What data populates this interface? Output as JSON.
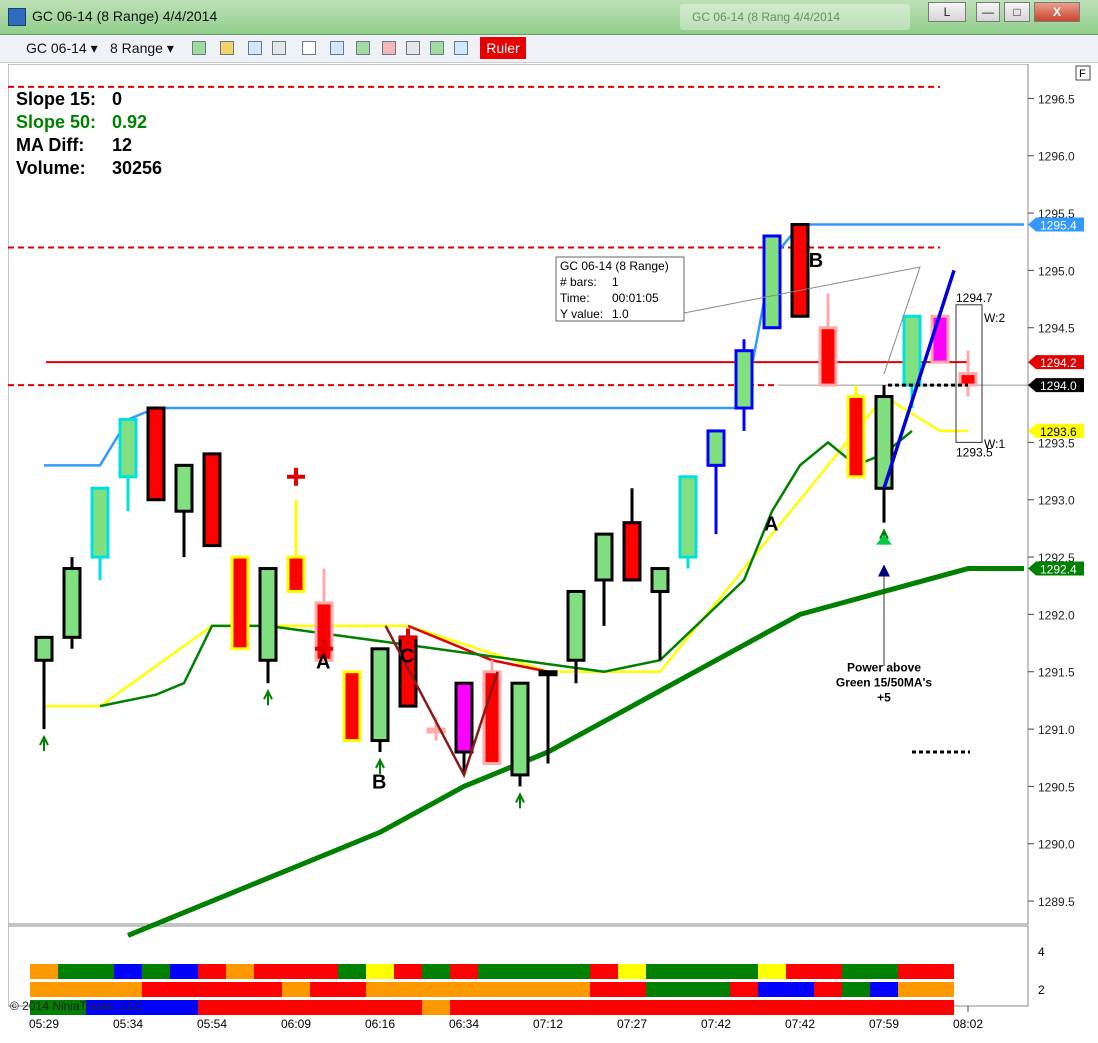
{
  "window": {
    "title": "GC 06-14 (8 Range)  4/4/2014",
    "background_title": "GC 06-14 (8 Rang   4/4/2014",
    "layout_button": "L",
    "minimize_label": "—",
    "maximize_label": "□",
    "close_label": "X"
  },
  "toolbar": {
    "instrument": "GC 06-14",
    "interval": "8 Range",
    "ruler_label": "Ruler",
    "icons": [
      "bar-type-icon",
      "pencil-icon",
      "zoom-in-icon",
      "zoom-out-icon",
      "crosshair-icon",
      "magnifier-icon",
      "indicators-icon",
      "strategies-icon",
      "chart-style-icon",
      "dollar-icon",
      "properties-icon"
    ]
  },
  "panel": {
    "f_label": "F",
    "copyright": "© 2014 NinjaTrader, LLC"
  },
  "stats": [
    {
      "label": "Slope 15:",
      "value": "0",
      "color": "#000000"
    },
    {
      "label": "Slope 50:",
      "value": "0.92",
      "color": "#008000"
    },
    {
      "label": "MA Diff:",
      "value": "12",
      "color": "#000000"
    },
    {
      "label": "Volume:",
      "value": "30256",
      "color": "#000000"
    }
  ],
  "ruler_box": {
    "line1": "GC 06-14 (8 Range)",
    "line2_label": "# bars:",
    "line2_value": "1",
    "line3_label": "Time:",
    "line3_value": "00:01:05",
    "line4_label": "Y value:",
    "line4_value": "1.0"
  },
  "annotations": {
    "power_text_1": "Power above",
    "power_text_2": "Green 15/50MA's",
    "power_text_3": "+5",
    "target_high": "1294.7",
    "target_low": "1293.5",
    "w2": "W:2",
    "w1": "W:1",
    "abc": [
      {
        "text": "A",
        "x": 10,
        "y": 1291.6
      },
      {
        "text": "B",
        "x": 12,
        "y": 1290.55
      },
      {
        "text": "C",
        "x": 13,
        "y": 1291.65
      },
      {
        "text": "A",
        "x": 26,
        "y": 1292.8
      },
      {
        "text": "B",
        "x": 27.6,
        "y": 1295.1
      }
    ]
  },
  "colors": {
    "ma15_up": "#3399ff",
    "ma_yellow": "#ffff00",
    "ma_red": "#e00000",
    "ma_green_thin": "#008000",
    "ma_green_thick": "#008000",
    "bull_fill": "#80e080",
    "bear_fill": "#ff0000",
    "resistance": "#e00000"
  },
  "price_tags": [
    {
      "label": "1295.4",
      "value": 1295.4,
      "bg": "#3399ff",
      "fg": "#ffffff"
    },
    {
      "label": "1294.2",
      "value": 1294.2,
      "bg": "#e00000",
      "fg": "#ffffff"
    },
    {
      "label": "1294.0",
      "value": 1294.0,
      "bg": "#000000",
      "fg": "#ffffff"
    },
    {
      "label": "1293.6",
      "value": 1293.6,
      "bg": "#ffff00",
      "fg": "#000000"
    },
    {
      "label": "1292.4",
      "value": 1292.4,
      "bg": "#008000",
      "fg": "#ffffff"
    }
  ],
  "lower_panel": {
    "y_ticks": [
      "4",
      "2"
    ],
    "rows": [
      [
        "#ff9900",
        "#008000",
        "#008000",
        "#0000ff",
        "#008000",
        "#0000ff",
        "#ff0000",
        "#ff9900",
        "#ff0000",
        "#ff0000",
        "#ff0000",
        "#008000",
        "#ffff00",
        "#ff0000",
        "#008000",
        "#ff0000",
        "#008000",
        "#008000",
        "#008000",
        "#008000",
        "#ff0000",
        "#ffff00",
        "#008000",
        "#008000",
        "#008000",
        "#008000",
        "#ffff00",
        "#ff0000",
        "#ff0000",
        "#008000",
        "#008000",
        "#ff0000",
        "#ff0000"
      ],
      [
        "#ff9900",
        "#ff9900",
        "#ff9900",
        "#ff9900",
        "#ff0000",
        "#ff0000",
        "#ff0000",
        "#ff0000",
        "#ff0000",
        "#ff9900",
        "#ff0000",
        "#ff0000",
        "#ff9900",
        "#ff9900",
        "#ff9900",
        "#ff9900",
        "#ff9900",
        "#ff9900",
        "#ff9900",
        "#ff9900",
        "#ff0000",
        "#ff0000",
        "#008000",
        "#008000",
        "#008000",
        "#ff0000",
        "#0000ff",
        "#0000ff",
        "#ff0000",
        "#008000",
        "#0000ff",
        "#ff9900",
        "#ff9900"
      ],
      [
        "#008000",
        "#008000",
        "#0000ff",
        "#0000ff",
        "#0000ff",
        "#0000ff",
        "#ff0000",
        "#ff0000",
        "#ff0000",
        "#ff0000",
        "#ff0000",
        "#ff0000",
        "#ff0000",
        "#ff0000",
        "#ff9900",
        "#ff0000",
        "#ff0000",
        "#ff0000",
        "#ff0000",
        "#ff0000",
        "#ff0000",
        "#ff0000",
        "#ff0000",
        "#ff0000",
        "#ff0000",
        "#ff0000",
        "#ff0000",
        "#ff0000",
        "#ff0000",
        "#ff0000",
        "#ff0000",
        "#ff0000",
        "#ff0000"
      ]
    ]
  },
  "chart_data": {
    "type": "candlestick",
    "title": "GC 06-14 (8 Range)  4/4/2014",
    "ylim": [
      1289.3,
      1296.8
    ],
    "y_ticks": [
      "1296.5",
      "1296.0",
      "1295.5",
      "1295.0",
      "1294.5",
      "1294.0",
      "1293.5",
      "1293.0",
      "1292.5",
      "1292.0",
      "1291.5",
      "1291.0",
      "1290.5",
      "1290.0",
      "1289.5"
    ],
    "x_ticks": [
      {
        "label": "05:29",
        "x": 0
      },
      {
        "label": "05:34",
        "x": 3
      },
      {
        "label": "05:54",
        "x": 6
      },
      {
        "label": "06:09",
        "x": 9
      },
      {
        "label": "06:16",
        "x": 12
      },
      {
        "label": "06:34",
        "x": 15
      },
      {
        "label": "07:12",
        "x": 18
      },
      {
        "label": "07:27",
        "x": 21
      },
      {
        "label": "07:42",
        "x": 24
      },
      {
        "label": "07:42",
        "x": 27
      },
      {
        "label": "07:59",
        "x": 30
      },
      {
        "label": "08:02",
        "x": 33
      }
    ],
    "bars": [
      {
        "x": 0,
        "o": 1291.6,
        "h": 1291.8,
        "l": 1291.0,
        "c": 1291.8,
        "fill": "#80e080",
        "border": "#000000"
      },
      {
        "x": 1,
        "o": 1291.8,
        "h": 1292.5,
        "l": 1291.7,
        "c": 1292.4,
        "fill": "#80e080",
        "border": "#000000"
      },
      {
        "x": 2,
        "o": 1292.5,
        "h": 1293.1,
        "l": 1292.3,
        "c": 1293.1,
        "fill": "#80e080",
        "border": "#00e0e0"
      },
      {
        "x": 3,
        "o": 1293.2,
        "h": 1293.7,
        "l": 1292.9,
        "c": 1293.7,
        "fill": "#80e080",
        "border": "#00e0e0"
      },
      {
        "x": 4,
        "o": 1293.8,
        "h": 1293.8,
        "l": 1293.0,
        "c": 1293.0,
        "fill": "#ff0000",
        "border": "#000000"
      },
      {
        "x": 5,
        "o": 1292.9,
        "h": 1293.3,
        "l": 1292.5,
        "c": 1293.3,
        "fill": "#80e080",
        "border": "#000000"
      },
      {
        "x": 6,
        "o": 1293.4,
        "h": 1293.4,
        "l": 1292.6,
        "c": 1292.6,
        "fill": "#ff0000",
        "border": "#000000"
      },
      {
        "x": 7,
        "o": 1292.5,
        "h": 1292.5,
        "l": 1291.7,
        "c": 1291.7,
        "fill": "#ff0000",
        "border": "#ffff00"
      },
      {
        "x": 8,
        "o": 1291.6,
        "h": 1292.4,
        "l": 1291.4,
        "c": 1292.4,
        "fill": "#80e080",
        "border": "#000000"
      },
      {
        "x": 9,
        "o": 1292.5,
        "h": 1293.0,
        "l": 1292.2,
        "c": 1292.2,
        "fill": "#ff0000",
        "border": "#ffff00"
      },
      {
        "x": 10,
        "o": 1292.1,
        "h": 1292.4,
        "l": 1291.6,
        "c": 1291.6,
        "fill": "#ff0000",
        "border": "#ffaaaa"
      },
      {
        "x": 11,
        "o": 1291.5,
        "h": 1291.5,
        "l": 1290.9,
        "c": 1290.9,
        "fill": "#ff0000",
        "border": "#ffff00"
      },
      {
        "x": 12,
        "o": 1290.9,
        "h": 1291.7,
        "l": 1290.8,
        "c": 1291.7,
        "fill": "#80e080",
        "border": "#000000"
      },
      {
        "x": 13,
        "o": 1291.8,
        "h": 1291.8,
        "l": 1291.2,
        "c": 1291.2,
        "fill": "#ff0000",
        "border": "#000000"
      },
      {
        "x": 14,
        "o": 1291.0,
        "h": 1291.1,
        "l": 1290.9,
        "c": 1291.0,
        "fill": "#ff0000",
        "border": "#ffaaaa"
      },
      {
        "x": 15,
        "o": 1290.8,
        "h": 1291.4,
        "l": 1290.6,
        "c": 1291.4,
        "fill": "#ff00ff",
        "border": "#000000"
      },
      {
        "x": 16,
        "o": 1291.5,
        "h": 1291.6,
        "l": 1290.7,
        "c": 1290.7,
        "fill": "#ff0000",
        "border": "#ffaaaa"
      },
      {
        "x": 17,
        "o": 1290.6,
        "h": 1291.4,
        "l": 1290.5,
        "c": 1291.4,
        "fill": "#80e080",
        "border": "#000000"
      },
      {
        "x": 18,
        "o": 1291.5,
        "h": 1291.5,
        "l": 1290.7,
        "c": 1291.5,
        "fill": "#80e080",
        "border": "#000000"
      },
      {
        "x": 19,
        "o": 1291.6,
        "h": 1292.2,
        "l": 1291.4,
        "c": 1292.2,
        "fill": "#80e080",
        "border": "#000000"
      },
      {
        "x": 20,
        "o": 1292.3,
        "h": 1292.7,
        "l": 1291.9,
        "c": 1292.7,
        "fill": "#80e080",
        "border": "#000000"
      },
      {
        "x": 21,
        "o": 1292.8,
        "h": 1293.1,
        "l": 1292.3,
        "c": 1292.3,
        "fill": "#ff0000",
        "border": "#000000"
      },
      {
        "x": 22,
        "o": 1292.2,
        "h": 1292.4,
        "l": 1291.6,
        "c": 1292.4,
        "fill": "#80e080",
        "border": "#000000"
      },
      {
        "x": 23,
        "o": 1292.5,
        "h": 1293.2,
        "l": 1292.4,
        "c": 1293.2,
        "fill": "#80e080",
        "border": "#00e0e0"
      },
      {
        "x": 24,
        "o": 1293.3,
        "h": 1293.6,
        "l": 1292.7,
        "c": 1293.6,
        "fill": "#80e080",
        "border": "#0000ff"
      },
      {
        "x": 25,
        "o": 1293.8,
        "h": 1294.4,
        "l": 1293.6,
        "c": 1294.3,
        "fill": "#80e080",
        "border": "#0000ff"
      },
      {
        "x": 26,
        "o": 1294.5,
        "h": 1295.3,
        "l": 1294.5,
        "c": 1295.3,
        "fill": "#80e080",
        "border": "#0000ff"
      },
      {
        "x": 27,
        "o": 1295.4,
        "h": 1295.4,
        "l": 1294.6,
        "c": 1294.6,
        "fill": "#ff0000",
        "border": "#000000"
      },
      {
        "x": 28,
        "o": 1294.5,
        "h": 1294.8,
        "l": 1294.0,
        "c": 1294.0,
        "fill": "#ff0000",
        "border": "#ffaaaa"
      },
      {
        "x": 29,
        "o": 1293.9,
        "h": 1294.0,
        "l": 1293.2,
        "c": 1293.2,
        "fill": "#ff0000",
        "border": "#ffff00"
      },
      {
        "x": 30,
        "o": 1293.1,
        "h": 1294.0,
        "l": 1292.8,
        "c": 1293.9,
        "fill": "#80e080",
        "border": "#000000"
      },
      {
        "x": 31,
        "o": 1294.0,
        "h": 1294.6,
        "l": 1293.8,
        "c": 1294.6,
        "fill": "#80e080",
        "border": "#00e0e0"
      },
      {
        "x": 32,
        "o": 1294.6,
        "h": 1294.6,
        "l": 1294.2,
        "c": 1294.2,
        "fill": "#ff00ff",
        "border": "#ffaaaa"
      },
      {
        "x": 33,
        "o": 1294.1,
        "h": 1294.3,
        "l": 1293.9,
        "c": 1294.0,
        "fill": "#ff0000",
        "border": "#ffaaaa"
      }
    ],
    "series": [
      {
        "name": "MA15 high",
        "color": "#3399ff",
        "x": [
          0,
          2,
          3,
          4,
          25,
          26,
          27,
          35
        ],
        "y": [
          1293.3,
          1293.3,
          1293.7,
          1293.8,
          1293.8,
          1295.1,
          1295.4,
          1295.4
        ]
      },
      {
        "name": "MA15 line",
        "color": "#ffff00",
        "x": [
          0,
          2,
          6,
          13,
          18,
          22,
          30,
          32,
          33
        ],
        "y": [
          1291.2,
          1291.2,
          1291.9,
          1291.9,
          1291.5,
          1291.5,
          1293.9,
          1293.6,
          1293.6
        ]
      },
      {
        "name": "MA15 red",
        "color": "#e00000",
        "x": [
          13,
          16,
          18,
          18.3
        ],
        "y": [
          1291.9,
          1291.6,
          1291.5,
          1291.5
        ]
      },
      {
        "name": "MA15 green",
        "color": "#008000",
        "x": [
          2,
          4,
          5,
          6,
          8,
          20,
          22,
          25,
          26,
          27,
          28,
          29,
          30,
          31
        ],
        "y": [
          1291.2,
          1291.3,
          1291.4,
          1291.9,
          1291.9,
          1291.5,
          1291.6,
          1292.3,
          1292.9,
          1293.3,
          1293.5,
          1293.3,
          1293.4,
          1293.6
        ]
      },
      {
        "name": "MA50 thick green",
        "color": "#008000",
        "x": [
          3,
          6,
          9,
          12,
          15,
          18,
          21,
          24,
          27,
          30,
          33,
          35
        ],
        "y": [
          1289.2,
          1289.5,
          1289.8,
          1290.1,
          1290.5,
          1290.8,
          1291.2,
          1291.6,
          1292.0,
          1292.2,
          1292.4,
          1292.4
        ]
      }
    ],
    "levels": [
      {
        "name": "resistance-top",
        "value": 1296.6,
        "style": "dashed"
      },
      {
        "name": "resistance-2",
        "value": 1295.2,
        "style": "dashed"
      },
      {
        "name": "support-solid",
        "value": 1294.2,
        "style": "solid"
      },
      {
        "name": "support-dashed",
        "value": 1294.0,
        "style": "dashed"
      }
    ]
  }
}
